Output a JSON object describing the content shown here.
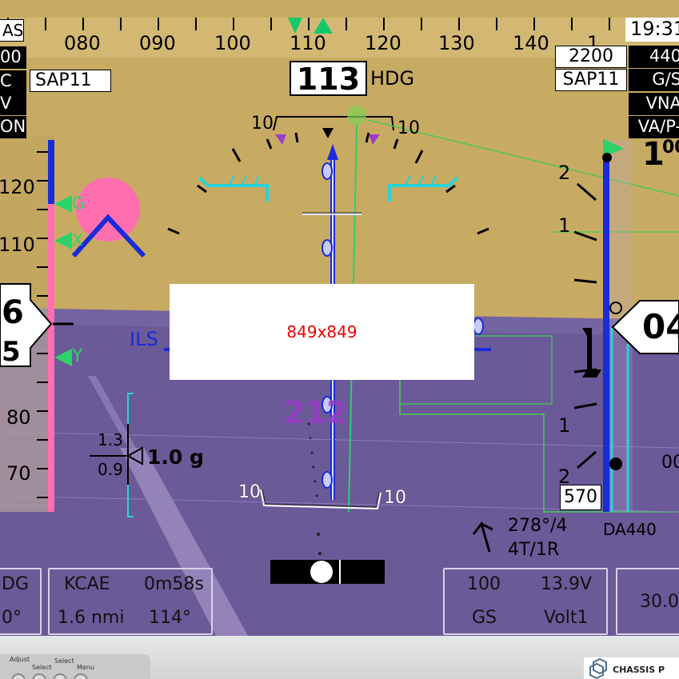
{
  "heading_tape": {
    "labels": [
      "080",
      "090",
      "100",
      "110",
      "120",
      "130",
      "140"
    ],
    "partial_right": "1"
  },
  "heading_readout": {
    "value": "113",
    "label": "HDG"
  },
  "clock": "19:31",
  "left_boxes": {
    "airspeed_label": "AS",
    "row2": "00",
    "row3": "C",
    "row4": "V",
    "row5": "ON",
    "sap_label": "SAP11"
  },
  "right_boxes": {
    "altitude_target": "2200",
    "sap_label": "SAP11",
    "r1": "440",
    "r2": "G/S",
    "r3": "VNA",
    "r4": "VA/P-",
    "alt_top": "1",
    "alt_top_small": "00"
  },
  "airspeed_tape": {
    "labels": [
      "120",
      "110",
      "80",
      "70"
    ],
    "readout_top": "6",
    "readout_bottom": "5",
    "bug_labels": [
      "G",
      "X",
      "Y"
    ]
  },
  "altitude_tape": {
    "labels": [
      "2",
      "1",
      "1",
      "2"
    ],
    "readout": "04",
    "right_small": "00",
    "bottom_box": "570"
  },
  "pitch_ladder": {
    "labels": [
      "10",
      "10",
      "10",
      "10"
    ]
  },
  "ils_label": "ILS",
  "g_meter": {
    "upper": "1.3",
    "lower": "0.9",
    "value": "1.0 g"
  },
  "waypoint_heading": "212",
  "wind": {
    "direction": "278°/4",
    "runway": "4T/1R"
  },
  "da_label": "DA440",
  "placeholder": "849x849",
  "bottom_panels": {
    "left": {
      "top": "DG",
      "bottom": "0°"
    },
    "nav": {
      "airport": "KCAE",
      "time": "0m58s",
      "distance": "1.6 nmi",
      "bearing": "114°"
    },
    "engine": {
      "rpm": "100",
      "volt": "13.9V",
      "gs": "GS",
      "volt_label": "Volt1"
    },
    "right": {
      "value": "30.0"
    }
  },
  "bezel": {
    "labels": [
      "Adjust",
      "Select",
      "Select",
      "Menu"
    ],
    "brand": "CHASSIS P"
  },
  "colors": {
    "sky": "#c8ab62",
    "ground": "#6a5a97",
    "magenta": "#ff6fb0",
    "cyan": "#29d3d6",
    "blue": "#1a2bd8",
    "green": "#2bd36a",
    "purple_wp": "#9a3cc8"
  }
}
